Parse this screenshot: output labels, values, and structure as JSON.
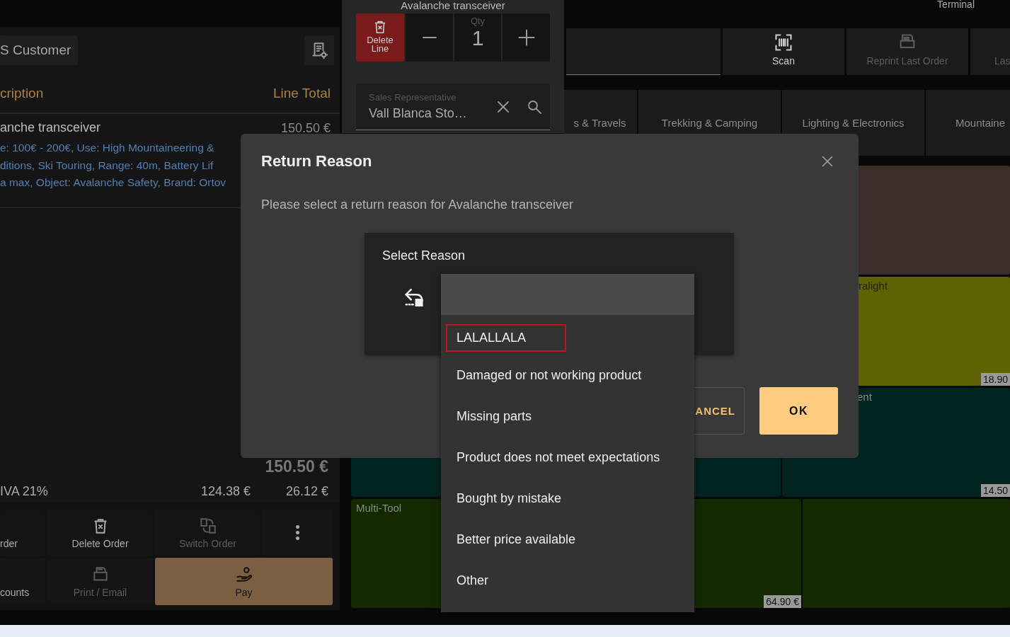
{
  "header": {
    "terminal_label": "Terminal"
  },
  "customer_button": {
    "label": "S Customer"
  },
  "order_table": {
    "columns": [
      "cription",
      "Line Total"
    ],
    "lines": [
      {
        "name": "anche transceiver",
        "total": "150.50 €",
        "description_lines": [
          "e: 100€ - 200€, Use: High Mountaineering &",
          "ditions, Ski Touring, Range: 40m, Battery Lif",
          "a max, Object: Avalanche Safety, Brand: Ortov"
        ]
      }
    ]
  },
  "totals": {
    "total": "150.50 €",
    "tax_label": "IVA 21%",
    "tax_base": "124.38 €",
    "tax_amount": "26.12 €"
  },
  "actions": [
    {
      "label": "rder",
      "kind": "partial",
      "disabled": false
    },
    {
      "label": "Delete Order",
      "kind": "trash",
      "disabled": false
    },
    {
      "label": "Switch Order",
      "kind": "switch",
      "disabled": true
    },
    {
      "kind": "more",
      "disabled": false
    },
    {
      "label": "counts",
      "kind": "partial",
      "disabled": false
    },
    {
      "label": "Print / Email",
      "kind": "print",
      "disabled": true
    },
    {
      "label": "Pay",
      "kind": "pay",
      "disabled": false
    }
  ],
  "line_editor": {
    "title": "Avalanche transceiver",
    "delete_label": "Delete Line",
    "qty_label": "Qty",
    "qty": "1",
    "sales_rep": {
      "label": "Sales Representative",
      "value": "Vall Blanca Sto…"
    }
  },
  "toolbar": [
    {
      "label": "Scan",
      "kind": "scan",
      "disabled": false
    },
    {
      "label": "Reprint Last Order",
      "kind": "reprint",
      "disabled": true
    },
    {
      "label": "Las",
      "kind": "partial",
      "disabled": true
    }
  ],
  "categories": [
    "s & Travels",
    "Trekking & Camping",
    "Lighting & Electronics",
    "Mountaine"
  ],
  "products": [
    {
      "color": "#3a2d2a"
    },
    {
      "label": "ralight",
      "price": "18.90",
      "color": "#5f6200"
    },
    {
      "color": "#00241f"
    },
    {
      "label": "ent",
      "price": "14.50",
      "color": "#00241f"
    },
    {
      "label": "Multi-Tool",
      "price": "64.90 €",
      "color": "#132a00"
    },
    {
      "color": "#132a00"
    }
  ],
  "dialog": {
    "title": "Return Reason",
    "message": "Please select a return reason for Avalanche transceiver",
    "field_label": "Select Reason",
    "buttons": [
      {
        "label": "ANCEL",
        "kind": "secondary"
      },
      {
        "label": "OK",
        "kind": "primary"
      }
    ]
  },
  "dropdown": {
    "options": [
      {
        "label": "LALALLALA",
        "focused": true
      },
      {
        "label": "Damaged or not working product",
        "focused": false
      },
      {
        "label": "Missing parts",
        "focused": false
      },
      {
        "label": "Product does not meet expectations",
        "focused": false
      },
      {
        "label": "Bought by mistake",
        "focused": false
      },
      {
        "label": "Better price available",
        "focused": false
      },
      {
        "label": "Other",
        "focused": false
      }
    ]
  }
}
